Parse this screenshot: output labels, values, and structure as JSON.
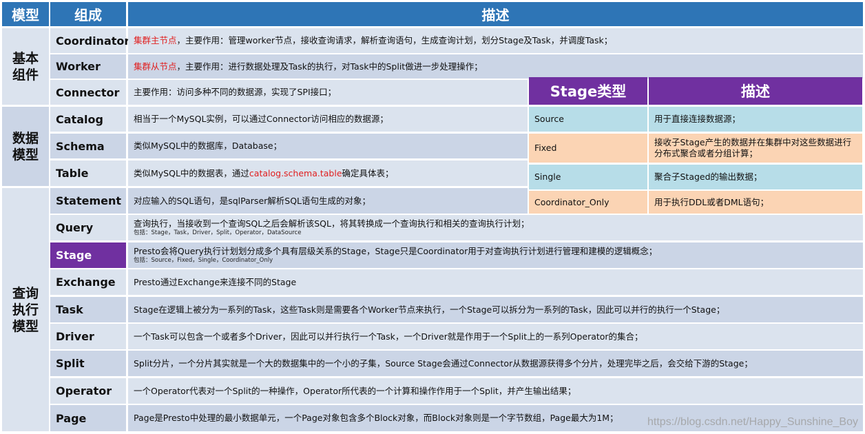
{
  "headers": {
    "model": "模型",
    "component": "组成",
    "description": "描述"
  },
  "groups": [
    {
      "id": "basic",
      "label": "基本\n组件"
    },
    {
      "id": "data",
      "label": "数据\n模型"
    },
    {
      "id": "query",
      "label": "查询\n执行\n模型"
    }
  ],
  "rows": [
    {
      "component": "Coordinator",
      "red": "集群主节点",
      "text": "，主要作用：管理worker节点，接收查询请求，解析查询语句，生成查询计划，划分Stage及Task，并调度Task；"
    },
    {
      "component": "Worker",
      "red": "集群从节点",
      "text": "，主要作用：进行数据处理及Task的执行，对Task中的Split做进一步处理操作；"
    },
    {
      "component": "Connector",
      "text": "主要作用：访问多种不同的数据源，实现了SPI接口；"
    },
    {
      "component": "Catalog",
      "text": "相当于一个MySQL实例，可以通过Connector访问相应的数据源；"
    },
    {
      "component": "Schema",
      "text": "类似MySQL中的数据库，Database；"
    },
    {
      "component": "Table",
      "text": "类似MySQL中的数据表，通过",
      "red_mid": "catalog.schema.table",
      "text_after": "确定具体表；"
    },
    {
      "component": "Statement",
      "text": "对应输入的SQL语句，是sqlParser解析SQL语句生成的对象；"
    },
    {
      "component": "Query",
      "text": "查询执行，当接收到一个查询SQL之后会解析该SQL，将其转换成一个查询执行和相关的查询执行计划；",
      "sub": "包括：Stage，Task，Driver，Split，Operator，DataSource"
    },
    {
      "component": "Stage",
      "text": "Presto会将Query执行计划划分成多个具有层级关系的Stage，Stage只是Coordinator用于对查询执行计划进行管理和建模的逻辑概念；",
      "sub": "包括：Source，Fixed，Single，Coordinator_Only"
    },
    {
      "component": "Exchange",
      "text": "Presto通过Exchange来连接不同的Stage"
    },
    {
      "component": "Task",
      "text": "Stage在逻辑上被分为一系列的Task，这些Task则是需要各个Worker节点来执行，一个Stage可以拆分为一系列的Task，因此可以并行的执行一个Stage；"
    },
    {
      "component": "Driver",
      "text": "一个Task可以包含一个或者多个Driver，因此可以并行执行一个Task，一个Driver就是作用于一个Split上的一系列Operator的集合；"
    },
    {
      "component": "Split",
      "text": "Split分片，一个分片其实就是一个大的数据集中的一个小的子集，Source Stage会通过Connector从数据源获得多个分片，处理完毕之后，会交给下游的Stage；"
    },
    {
      "component": "Operator",
      "text": "一个Operator代表对一个Split的一种操作，Operator所代表的一个计算和操作作用于一个Split，并产生输出结果；"
    },
    {
      "component": "Page",
      "text": "Page是Presto中处理的最小数据单元，一个Page对象包含多个Block对象，而Block对象则是一个字节数组，Page最大为1M；"
    }
  ],
  "stage_table": {
    "headers": {
      "type": "Stage类型",
      "description": "描述"
    },
    "rows": [
      {
        "type": "Source",
        "description": "用于直接连接数据源；"
      },
      {
        "type": "Fixed",
        "description": "接收子Stage产生的数据并在集群中对这些数据进行分布式聚合或者分组计算；"
      },
      {
        "type": "Single",
        "description": "聚合子Staged的输出数据；"
      },
      {
        "type": "Coordinator_Only",
        "description": "用于执行DDL或者DML语句；"
      }
    ]
  },
  "watermark": "https://blog.csdn.net/Happy_Sunshine_Boy",
  "colors": {
    "header_blue": "#2e75b6",
    "stage_purple": "#7030a0",
    "highlight_red": "#e02020",
    "cyan": "#b7dde8",
    "peach": "#fbd4b4"
  }
}
